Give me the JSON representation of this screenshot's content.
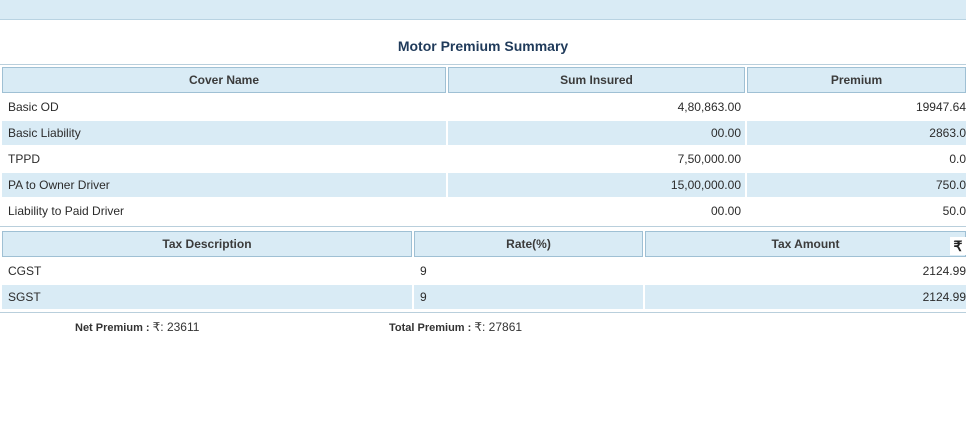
{
  "page_title": "Motor Premium Summary",
  "cover_table": {
    "headers": [
      "Cover Name",
      "Sum Insured",
      "Premium"
    ],
    "rows": [
      {
        "name": "Basic OD",
        "sum_insured": "4,80,863.00",
        "premium": "19947.64"
      },
      {
        "name": "Basic Liability",
        "sum_insured": "00.00",
        "premium": "2863.0"
      },
      {
        "name": "TPPD",
        "sum_insured": "7,50,000.00",
        "premium": "0.0"
      },
      {
        "name": "PA to Owner Driver",
        "sum_insured": "15,00,000.00",
        "premium": "750.0"
      },
      {
        "name": "Liability to Paid Driver",
        "sum_insured": "00.00",
        "premium": "50.0"
      }
    ]
  },
  "tax_table": {
    "headers": [
      "Tax Description",
      "Rate(%)",
      "Tax Amount"
    ],
    "currency_symbol": "₹",
    "rows": [
      {
        "description": "CGST",
        "rate": "9",
        "amount": "2124.99"
      },
      {
        "description": "SGST",
        "rate": "9",
        "amount": "2124.99"
      }
    ]
  },
  "summary": {
    "net_premium_label": "Net Premium :",
    "net_premium_value": "₹: 23611",
    "total_premium_label": "Total Premium :",
    "total_premium_value": "₹: 27861"
  },
  "colors": {
    "header_bg": "#d9ebf5",
    "title_color": "#1f3a5a",
    "border": "#9fc0d4"
  }
}
